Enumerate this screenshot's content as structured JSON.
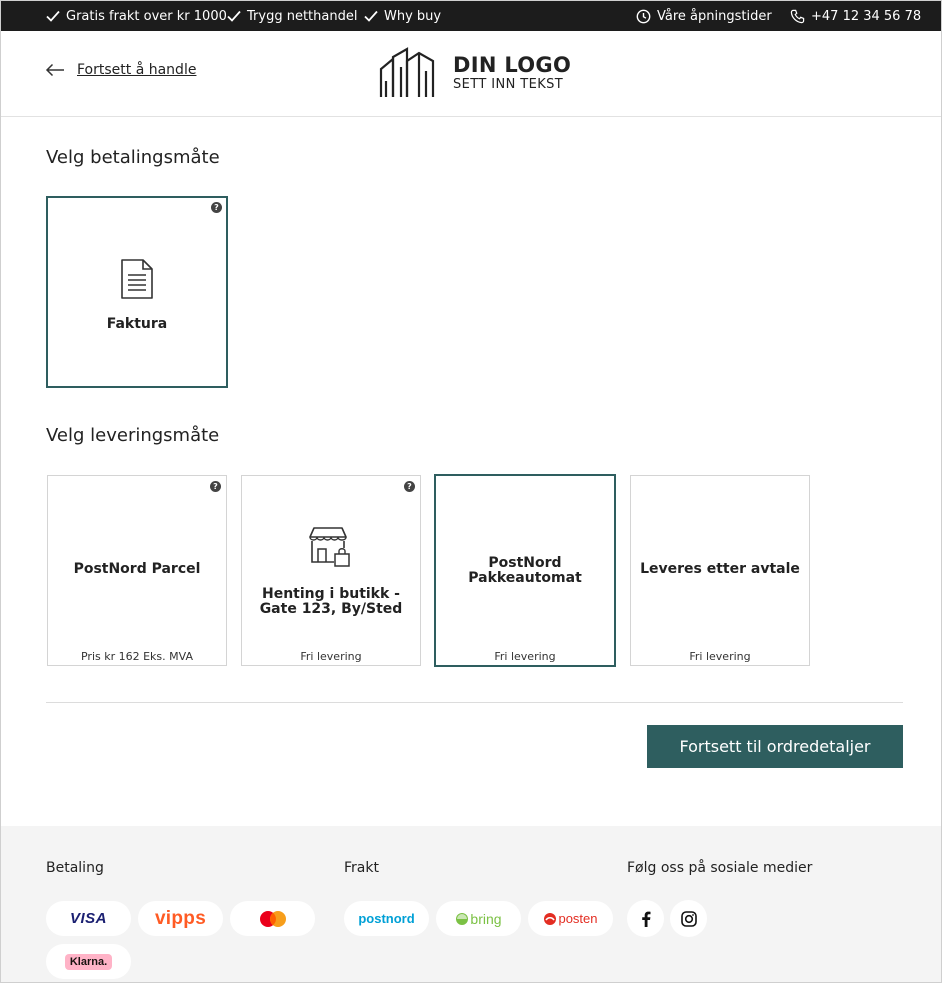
{
  "topbar": {
    "usp": [
      "Gratis frakt over kr 1000",
      "Trygg netthandel",
      "Why buy"
    ],
    "opening_hours": "Våre åpningstider",
    "phone": "+47 12 34 56 78"
  },
  "header": {
    "back_label": "Fortsett å handle",
    "logo_title": "DIN LOGO",
    "logo_subtitle": "SETT INN TEKST"
  },
  "payment": {
    "title": "Velg betalingsmåte",
    "options": [
      {
        "label": "Faktura",
        "icon": "invoice-icon",
        "selected": true
      }
    ]
  },
  "delivery": {
    "title": "Velg leveringsmåte",
    "options": [
      {
        "label": "PostNord Parcel",
        "price": "Pris kr 162 Eks. MVA",
        "selected": false
      },
      {
        "label": "Henting i butikk - Gate 123, By/Sted",
        "price": "Fri levering",
        "icon": "store-icon",
        "selected": false
      },
      {
        "label": "PostNord Pakkeautomat",
        "price": "Fri levering",
        "selected": true
      },
      {
        "label": "Leveres etter avtale",
        "price": "Fri levering",
        "selected": false
      }
    ]
  },
  "cta_label": "Fortsett til ordredetaljer",
  "footer": {
    "payment_title": "Betaling",
    "shipping_title": "Frakt",
    "social_title": "Følg oss på sosiale medier",
    "payment_logos": [
      "VISA",
      "vipps",
      "mastercard",
      "Klarna."
    ],
    "shipping_logos": [
      "postnord",
      "bring",
      "posten"
    ],
    "social": [
      "facebook-icon",
      "instagram-icon"
    ]
  },
  "colors": {
    "accent": "#2e5e5f",
    "topbar": "#1c1c1c",
    "footer_bg": "#f4f4f4"
  }
}
